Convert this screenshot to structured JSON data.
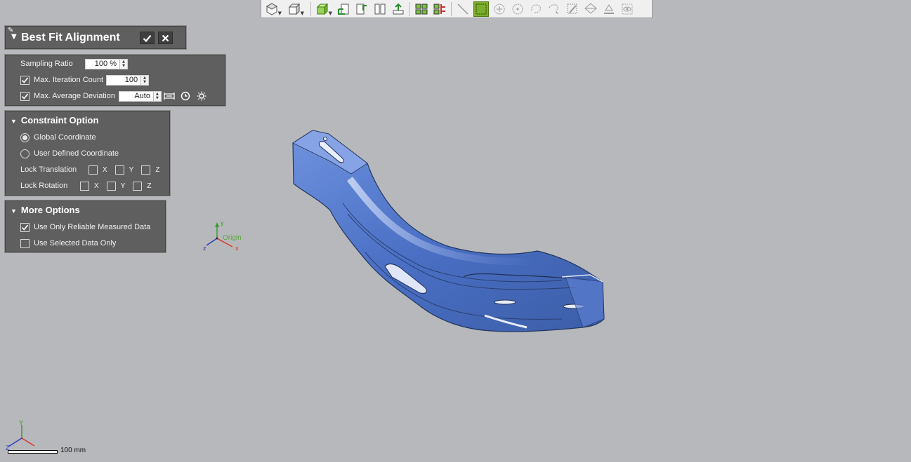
{
  "toolbar": {
    "items": [
      "view-cube-icon",
      "box-view-icon",
      "iso-view-icon",
      "front-view-icon",
      "top-view-icon",
      "split-view-icon",
      "up-direction-icon",
      "grid-layout-icon",
      "align-compare-icon",
      "line-select-icon",
      "rect-select-icon",
      "circle-select-icon",
      "polygon-select-icon",
      "lasso-select-icon",
      "freeform-select-icon",
      "brush-select-icon",
      "extend-select-icon",
      "flood-select-icon",
      "visible-only-icon"
    ]
  },
  "dialog": {
    "title": "Best Fit Alignment",
    "ok_icon": "check-icon",
    "cancel_icon": "close-icon"
  },
  "params": {
    "sampling_ratio_label": "Sampling Ratio",
    "sampling_ratio_value": "100 %",
    "max_iteration_label": "Max. Iteration Count",
    "max_iteration_value": "100",
    "max_iteration_checked": true,
    "max_avg_dev_label": "Max. Average Deviation",
    "max_avg_dev_value": "Auto",
    "max_avg_dev_checked": true
  },
  "constraint": {
    "header": "Constraint Option",
    "global_label": "Global Coordinate",
    "user_defined_label": "User Defined Coordinate",
    "selected": "global",
    "lock_translation_label": "Lock Translation",
    "lock_rotation_label": "Lock Rotation",
    "axes": [
      "X",
      "Y",
      "Z"
    ]
  },
  "more": {
    "header": "More Options",
    "reliable_label": "Use Only Reliable Measured Data",
    "reliable_checked": true,
    "selected_only_label": "Use Selected Data Only",
    "selected_only_checked": false
  },
  "viewport": {
    "origin_label": "Origin",
    "axis_x": "x",
    "axis_y": "y",
    "axis_z": "z",
    "triad_x": "X",
    "triad_y": "Y",
    "triad_z": "Z",
    "scale_label": "100 mm",
    "model_color": "#4f74c6"
  }
}
